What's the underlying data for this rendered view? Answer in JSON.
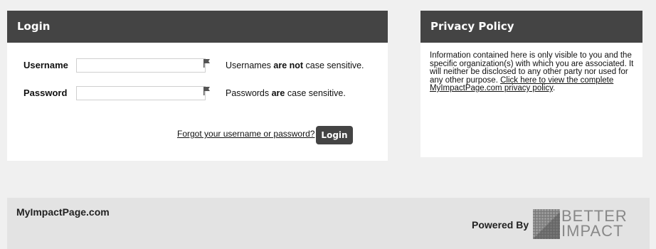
{
  "login": {
    "header": "Login",
    "username_label": "Username",
    "username_value": "",
    "username_hint_pre": "Usernames ",
    "username_hint_bold": "are not",
    "username_hint_post": " case sensitive.",
    "password_label": "Password",
    "password_value": "",
    "password_hint_pre": "Passwords ",
    "password_hint_bold": "are",
    "password_hint_post": " case sensitive.",
    "forgot_link": "Forgot your username or password?",
    "submit_label": "Login"
  },
  "privacy": {
    "header": "Privacy Policy",
    "body": "Information contained here is only visible to you and the specific organization(s) with which you are associated. It will neither be disclosed to any other party nor used for any other purpose. ",
    "link": "Click here to view the complete MyImpactPage.com privacy policy",
    "end": "."
  },
  "footer": {
    "site_name": "MyImpactPage.com",
    "powered_by": "Powered By",
    "logo_word1": "BETTER",
    "logo_word2": "IMPACT"
  },
  "colors": {
    "header_bg": "#444444",
    "page_bg": "#f0f0f0",
    "footer_bg": "#e3e3e3"
  },
  "icons": {
    "field_flag": "flag-icon",
    "logo": "better-impact-grid-logo"
  }
}
